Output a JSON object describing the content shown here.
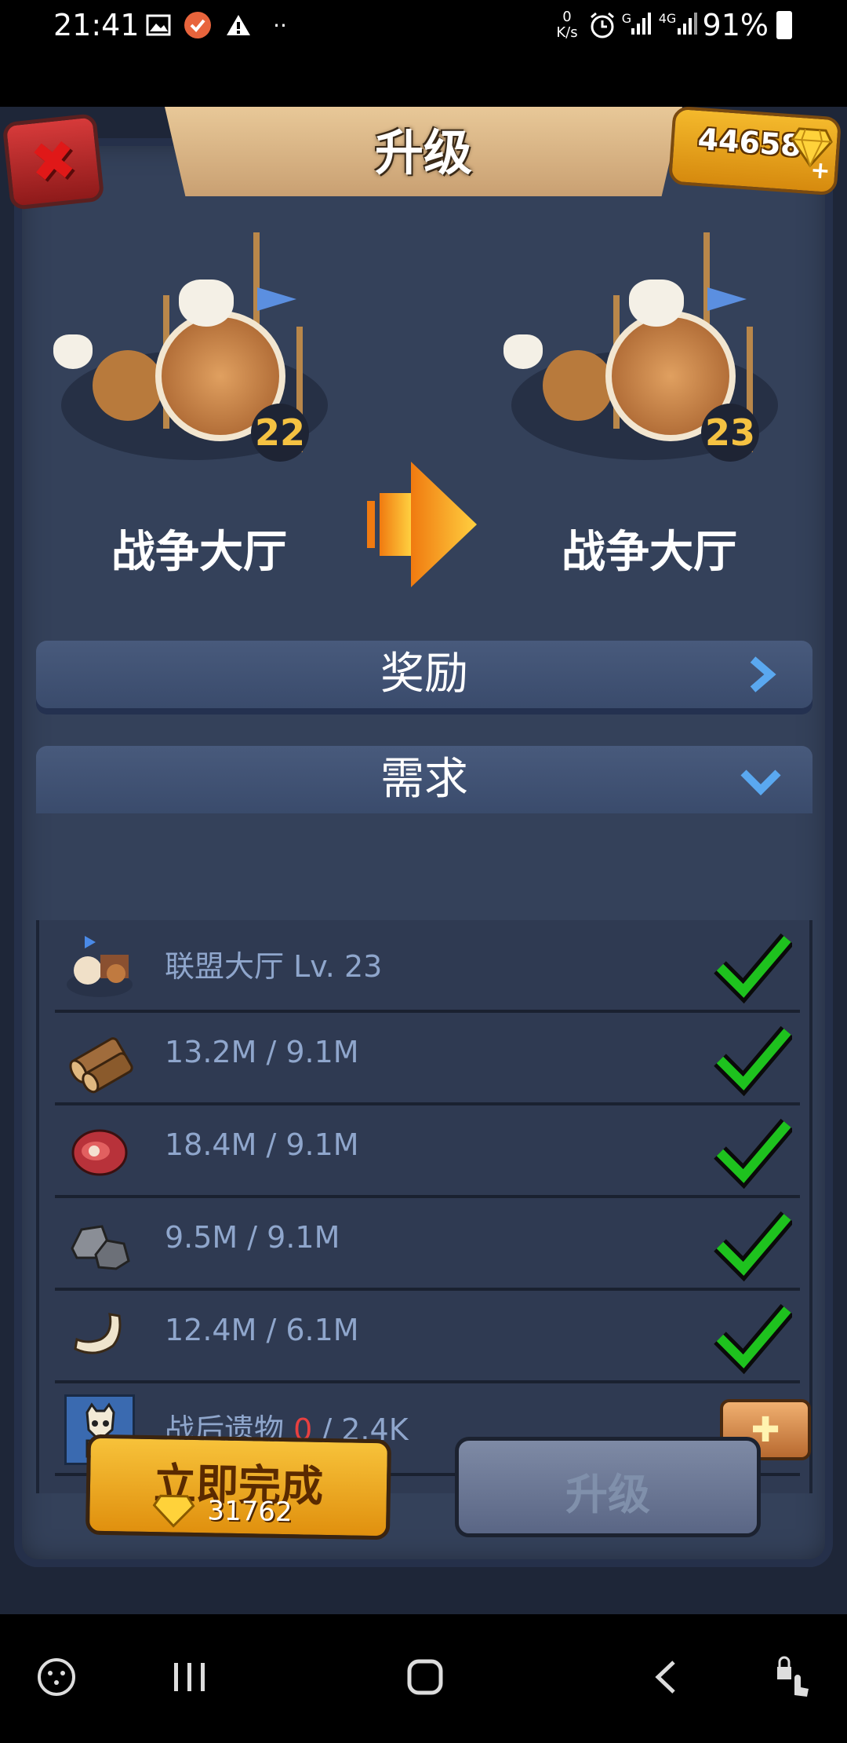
{
  "status_bar": {
    "time": "21:41",
    "net_speed_top": "0",
    "net_speed_unit": "K/s",
    "signal_label_1": "G",
    "signal_label_2": "4G",
    "battery": "91%"
  },
  "header": {
    "title": "升级",
    "gems": "44658"
  },
  "buildings": {
    "current": {
      "name": "战争大厅",
      "level": "22"
    },
    "next": {
      "name": "战争大厅",
      "level": "23"
    }
  },
  "sections": {
    "rewards_label": "奖励",
    "requirements_label": "需求"
  },
  "requirements": [
    {
      "text": "联盟大厅 Lv. 23",
      "icon": "alliance-hall-icon",
      "met": true
    },
    {
      "text": "13.2M / 9.1M",
      "icon": "wood-icon",
      "met": true
    },
    {
      "text": "18.4M / 9.1M",
      "icon": "meat-icon",
      "met": true
    },
    {
      "text": "9.5M / 9.1M",
      "icon": "stone-icon",
      "met": true
    },
    {
      "text": "12.4M / 6.1M",
      "icon": "bone-icon",
      "met": true
    },
    {
      "name": "战后遗物",
      "have": "0",
      "need": " / 2.4K",
      "icon": "relic-icon",
      "met": false
    }
  ],
  "buttons": {
    "finish_now": "立即完成",
    "finish_cost": "31762",
    "upgrade": "升级"
  },
  "colors": {
    "panel": "#34415a",
    "accent_gold": "#f5c242",
    "check_green": "#1ec21e",
    "missing_red": "#e84040"
  }
}
